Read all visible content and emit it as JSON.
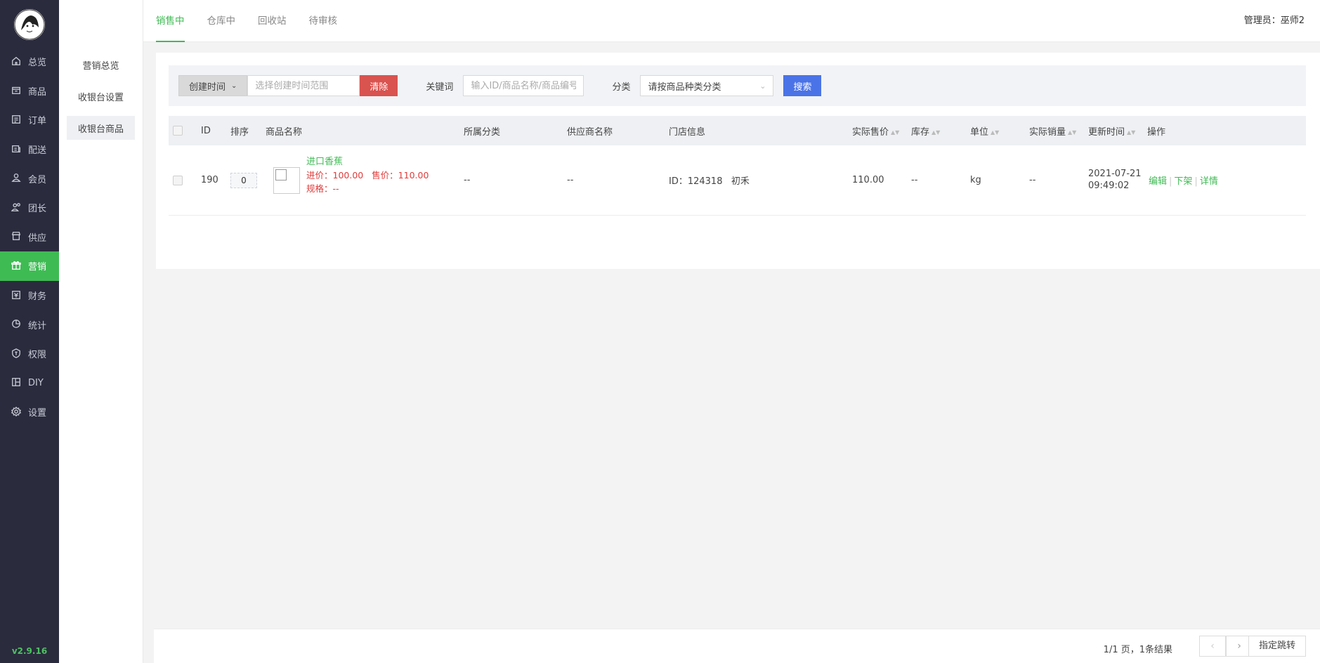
{
  "sidebar": {
    "items": [
      {
        "label": "总览",
        "icon": "home-icon"
      },
      {
        "label": "商品",
        "icon": "box-icon"
      },
      {
        "label": "订单",
        "icon": "order-icon"
      },
      {
        "label": "配送",
        "icon": "truck-icon"
      },
      {
        "label": "会员",
        "icon": "user-icon"
      },
      {
        "label": "团长",
        "icon": "group-icon"
      },
      {
        "label": "供应",
        "icon": "store-icon"
      },
      {
        "label": "营销",
        "icon": "gift-icon"
      },
      {
        "label": "财务",
        "icon": "finance-icon"
      },
      {
        "label": "统计",
        "icon": "chart-icon"
      },
      {
        "label": "权限",
        "icon": "shield-icon"
      },
      {
        "label": "DIY",
        "icon": "layout-icon"
      },
      {
        "label": "设置",
        "icon": "gear-icon"
      }
    ],
    "active_index": 7,
    "version": "v2.9.16",
    "accent": "#3fbb54"
  },
  "subnav": {
    "items": [
      "营销总览",
      "收银台设置",
      "收银台商品"
    ],
    "active_index": 2
  },
  "topbar": {
    "tabs": [
      "销售中",
      "仓库中",
      "回收站",
      "待审核"
    ],
    "active_index": 0,
    "admin_label": "管理员：",
    "admin_name": "巫师2"
  },
  "filter": {
    "date_dropdown": "创建时间",
    "date_placeholder": "选择创建时间范围",
    "clear_label": "清除",
    "keyword_label": "关键词",
    "keyword_placeholder": "输入ID/商品名称/商品编号",
    "category_label": "分类",
    "category_value": "请按商品种类分类",
    "search_label": "搜索"
  },
  "table": {
    "headers": {
      "id": "ID",
      "sort": "排序",
      "name": "商品名称",
      "category": "所属分类",
      "supplier": "供应商名称",
      "store": "门店信息",
      "price": "实际售价",
      "stock": "库存",
      "unit": "单位",
      "sales": "实际销量",
      "updated": "更新时间",
      "ops": "操作"
    },
    "rows": [
      {
        "id": "190",
        "sort": "0",
        "name": "进口香蕉",
        "cost_price": "进价：100.00",
        "sale_price": "售价：110.00",
        "spec": "规格：--",
        "category": "--",
        "supplier": "--",
        "store": "ID：124318   初禾",
        "price": "110.00",
        "stock": "--",
        "unit": "kg",
        "sales": "--",
        "updated_date": "2021-07-21",
        "updated_time": "09:49:02",
        "op_edit": "编辑",
        "op_off": "下架",
        "op_detail": "详情"
      }
    ]
  },
  "pager": {
    "info": "1/1 页，1条结果",
    "jump_label": "指定跳转"
  }
}
